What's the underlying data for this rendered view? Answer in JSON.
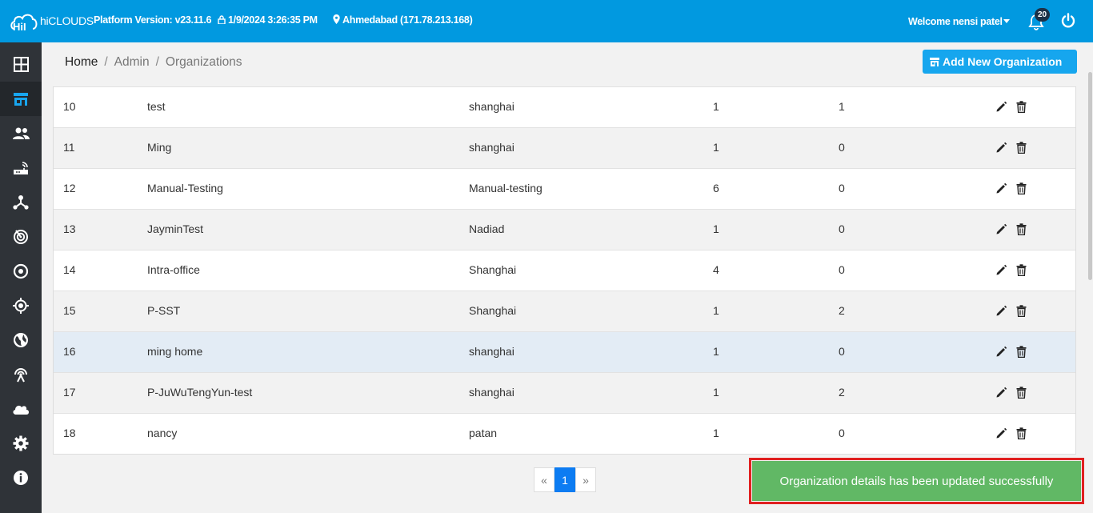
{
  "header": {
    "logo_text": "hiCLOUDS",
    "platform_version": "Platform Version: v23.11.6",
    "datetime": "1/9/2024 3:26:35 PM",
    "location": "Ahmedabad (171.78.213.168)",
    "welcome": "Welcome nensi patel",
    "notification_count": "20",
    "brand_color": "#0199e0"
  },
  "sidebar": {
    "items": [
      {
        "icon": "dashboard-icon"
      },
      {
        "icon": "store-icon",
        "active": true
      },
      {
        "icon": "users-icon"
      },
      {
        "icon": "router-icon"
      },
      {
        "icon": "network-icon"
      },
      {
        "icon": "radar-icon"
      },
      {
        "icon": "target-icon"
      },
      {
        "icon": "gps-icon"
      },
      {
        "icon": "globe-icon"
      },
      {
        "icon": "antenna-icon"
      },
      {
        "icon": "cloud-icon"
      },
      {
        "icon": "settings-icon"
      },
      {
        "icon": "info-icon"
      }
    ]
  },
  "breadcrumb": {
    "home": "Home",
    "admin": "Admin",
    "current": "Organizations",
    "separator": "/"
  },
  "add_button": {
    "label": "Add New Organization"
  },
  "table": {
    "rows": [
      {
        "id": "10",
        "name": "test",
        "city": "shanghai",
        "c4": "1",
        "c5": "1"
      },
      {
        "id": "11",
        "name": "Ming",
        "city": "shanghai",
        "c4": "1",
        "c5": "0"
      },
      {
        "id": "12",
        "name": "Manual-Testing",
        "city": "Manual-testing",
        "c4": "6",
        "c5": "0"
      },
      {
        "id": "13",
        "name": "JayminTest",
        "city": "Nadiad",
        "c4": "1",
        "c5": "0"
      },
      {
        "id": "14",
        "name": "Intra-office",
        "city": "Shanghai",
        "c4": "4",
        "c5": "0"
      },
      {
        "id": "15",
        "name": "P-SST",
        "city": "Shanghai",
        "c4": "1",
        "c5": "2"
      },
      {
        "id": "16",
        "name": "ming home",
        "city": "shanghai",
        "c4": "1",
        "c5": "0",
        "highlighted": true
      },
      {
        "id": "17",
        "name": "P-JuWuTengYun-test",
        "city": "shanghai",
        "c4": "1",
        "c5": "2"
      },
      {
        "id": "18",
        "name": "nancy",
        "city": "patan",
        "c4": "1",
        "c5": "0"
      }
    ]
  },
  "pagination": {
    "prev": "«",
    "current": "1",
    "next": "»"
  },
  "toast": {
    "message": "Organization details has been updated successfully",
    "color": "#61b865"
  }
}
